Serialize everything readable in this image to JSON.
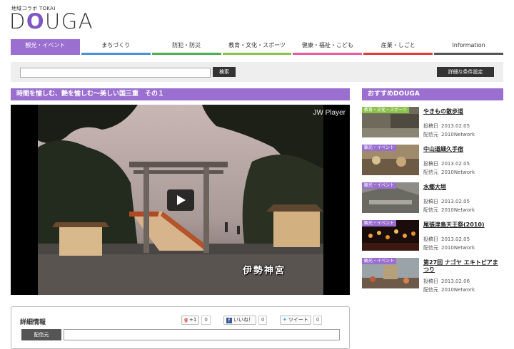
{
  "header": {
    "logo_sub": "地域コラボ TOKAI",
    "logo_pre": "D",
    "logo_o": "O",
    "logo_post": "UGA"
  },
  "nav": [
    {
      "label": "観光・イベント",
      "color": "#9b6fd0"
    },
    {
      "label": "まちづくり",
      "color": "#4a8fd8"
    },
    {
      "label": "防犯・防災",
      "color": "#4caf50"
    },
    {
      "label": "教育・文化・スポーツ",
      "color": "#8bc34a"
    },
    {
      "label": "健康・福祉・こども",
      "color": "#e85c9c"
    },
    {
      "label": "産業・しごと",
      "color": "#e53935"
    },
    {
      "label": "Information",
      "color": "#555555"
    }
  ],
  "search": {
    "placeholder": "",
    "button_label": "検索",
    "advanced_label": "詳細な条件設定"
  },
  "video": {
    "title": "時間を愉しむ、艶を愉しむ〜美しい国三重　その１",
    "player_label": "JW Player",
    "caption": "伊勢神宮"
  },
  "details": {
    "title": "詳細情報",
    "gplus_label": "+1",
    "gplus_count": "0",
    "fb_label": "いいね！",
    "fb_count": "0",
    "tw_label": "ツイート",
    "tw_count": "0",
    "distributor_label": "配信元"
  },
  "recommended": {
    "title": "おすすめDOUGA",
    "posted_label": "投稿日",
    "dist_label": "配信元",
    "items": [
      {
        "category": "教育・文化・スポーツ",
        "cat_color": "#8bc34a",
        "name": "やきもの散歩道",
        "date": "2013.02.05",
        "distributor": "2010Network"
      },
      {
        "category": "観光・イベント",
        "cat_color": "#9b6fd0",
        "name": "中山道細久手宿",
        "date": "2013.02.05",
        "distributor": "2010Network"
      },
      {
        "category": "観光・イベント",
        "cat_color": "#9b6fd0",
        "name": "水郷大垣",
        "date": "2013.02.05",
        "distributor": "2010Network"
      },
      {
        "category": "観光・イベント",
        "cat_color": "#9b6fd0",
        "name": "尾張津島天王祭(2010)",
        "date": "2013.02.05",
        "distributor": "2010Network"
      },
      {
        "category": "観光・イベント",
        "cat_color": "#9b6fd0",
        "name": "第27回 ナゴヤ エキトピアまつり",
        "date": "2013.02.06",
        "distributor": "2010Network"
      }
    ]
  }
}
